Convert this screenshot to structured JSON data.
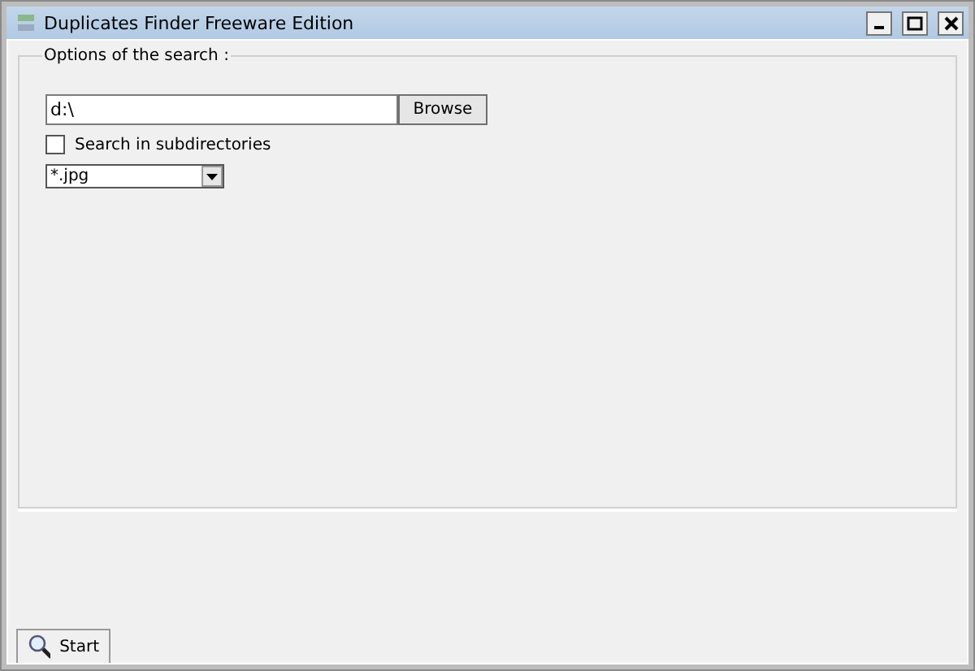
{
  "window": {
    "title": "Duplicates Finder Freeware Edition"
  },
  "options": {
    "legend": "Options of the search :",
    "folder": "d:\\",
    "browse": "Browse",
    "subdirectories": {
      "label": "Search in subdirectories",
      "checked": false
    },
    "filter": "*.jpg"
  },
  "start": "Start"
}
